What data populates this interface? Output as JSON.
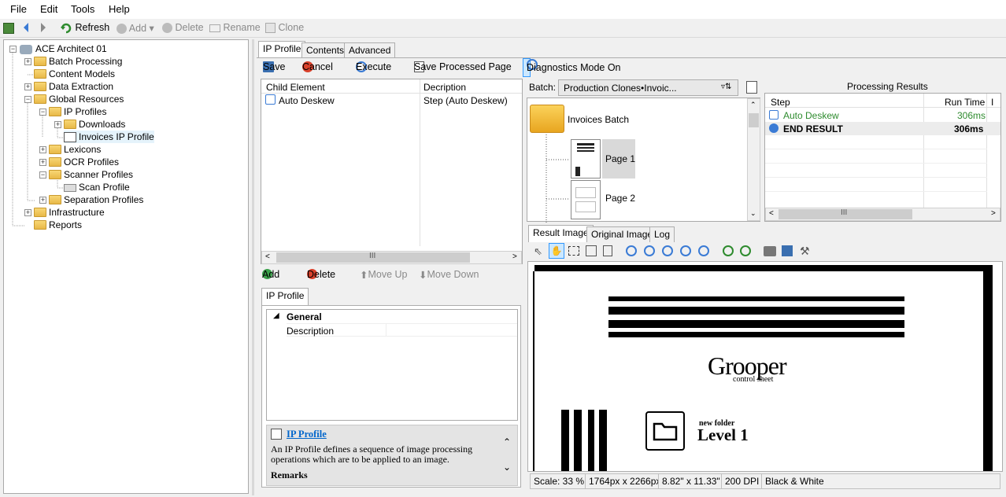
{
  "menu": [
    "File",
    "Edit",
    "Tools",
    "Help"
  ],
  "toolbar": {
    "refresh": "Refresh",
    "add": "Add",
    "delete": "Delete",
    "rename": "Rename",
    "clone": "Clone"
  },
  "tree": {
    "root": "ACE Architect 01",
    "items": [
      "Batch Processing",
      "Content Models",
      "Data Extraction",
      "Global Resources",
      "IP Profiles",
      "Downloads",
      "Invoices IP Profile",
      "Lexicons",
      "OCR Profiles",
      "Scanner Profiles",
      "Scan Profile",
      "Separation Profiles",
      "Infrastructure",
      "Reports"
    ]
  },
  "main_tabs": [
    "IP Profile",
    "Contents",
    "Advanced"
  ],
  "actions": {
    "save": "Save",
    "cancel": "Cancel",
    "execute": "Execute",
    "save_processed": "Save Processed Page",
    "diagnostics": "Diagnostics Mode On"
  },
  "child_grid": {
    "col1": "Child Element",
    "col2": "Decription",
    "rows": [
      {
        "name": "Auto Deskew",
        "desc": "Step (Auto Deskew)"
      }
    ]
  },
  "child_actions": {
    "add": "Add",
    "delete": "Delete",
    "move_up": "Move Up",
    "move_down": "Move Down"
  },
  "prop_tab": "IP Profile",
  "props": {
    "group": "General",
    "field": "Description"
  },
  "help": {
    "title": "IP Profile",
    "body": "An IP Profile defines a sequence of image processing operations which are to be applied to an image.",
    "remarks": "Remarks"
  },
  "batch": {
    "label": "Batch:",
    "value": "Production Clones•Invoic...",
    "root": "Invoices Batch",
    "pages": [
      "Page 1",
      "Page 2"
    ]
  },
  "results": {
    "title": "Processing Results",
    "col1": "Step",
    "col2": "Run Time",
    "rows": [
      {
        "step": "Auto Deskew",
        "time": "306ms"
      },
      {
        "step": "END RESULT",
        "time": "306ms"
      }
    ]
  },
  "image_tabs": [
    "Result Image",
    "Original Image",
    "Log"
  ],
  "doc": {
    "logo": "Grooper",
    "logo_sub": "control sheet",
    "folder_small": "new folder",
    "folder_big": "Level 1"
  },
  "status": {
    "scale": "Scale: 33 %",
    "px": "1764px x 2266px",
    "inches": "8.82\" x 11.33\"",
    "dpi": "200 DPI",
    "mode": "Black & White"
  },
  "colors": {
    "accent": "#0066cc",
    "green": "#2e8b2e",
    "select": "#cce8ff"
  }
}
